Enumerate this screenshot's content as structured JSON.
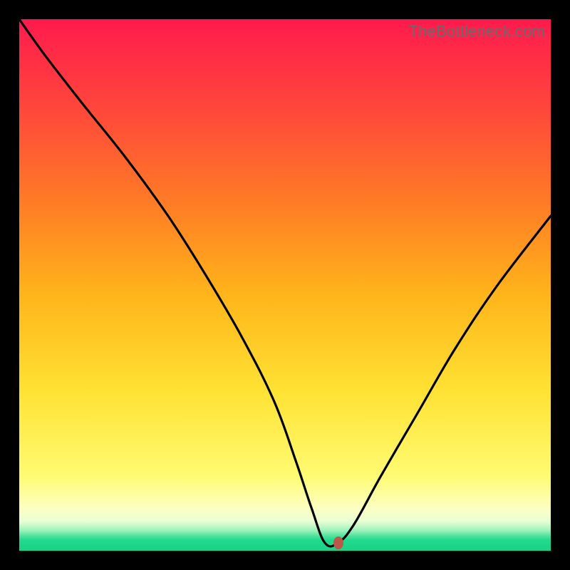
{
  "watermark": "TheBottleneck.com",
  "colors": {
    "frame": "#000000",
    "curve": "#000000",
    "marker": "#b9594a",
    "gradient_top": "#ff1a4d",
    "gradient_bottom": "#18d285"
  },
  "chart_data": {
    "type": "line",
    "title": "",
    "xlabel": "",
    "ylabel": "",
    "xlim": [
      0,
      100
    ],
    "ylim": [
      0,
      100
    ],
    "series": [
      {
        "name": "bottleneck-curve",
        "x": [
          0,
          5,
          12,
          20,
          28,
          35,
          42,
          48,
          52,
          55,
          57.5,
          60,
          63,
          68,
          75,
          82,
          90,
          100
        ],
        "values": [
          100,
          93,
          84,
          74,
          63,
          52,
          40,
          28,
          17,
          8,
          1.5,
          1.5,
          5,
          14,
          26,
          38,
          50,
          63
        ]
      }
    ],
    "marker": {
      "x": 60,
      "y": 1.5
    },
    "grid": false,
    "legend": false
  }
}
